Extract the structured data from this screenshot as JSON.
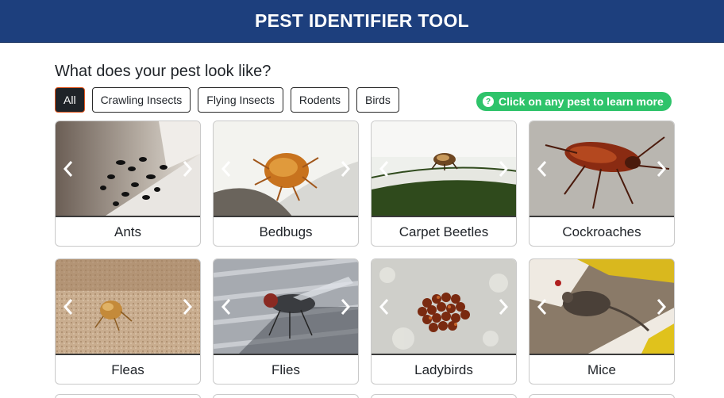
{
  "header": {
    "title": "PEST IDENTIFIER TOOL"
  },
  "question": "What does your pest look like?",
  "filters": [
    {
      "label": "All",
      "active": true
    },
    {
      "label": "Crawling Insects",
      "active": false
    },
    {
      "label": "Flying Insects",
      "active": false
    },
    {
      "label": "Rodents",
      "active": false
    },
    {
      "label": "Birds",
      "active": false
    }
  ],
  "hint": {
    "icon": "question-circle-icon",
    "text": "Click on any pest to learn more",
    "color": "#2ec36a"
  },
  "pests": [
    {
      "name": "Ants"
    },
    {
      "name": "Bedbugs"
    },
    {
      "name": "Carpet Beetles"
    },
    {
      "name": "Cockroaches"
    },
    {
      "name": "Fleas"
    },
    {
      "name": "Flies"
    },
    {
      "name": "Ladybirds"
    },
    {
      "name": "Mice"
    }
  ],
  "colors": {
    "header_bg": "#1d3f7d",
    "active_filter_bg": "#1f2328",
    "active_filter_border": "#e2561d"
  }
}
